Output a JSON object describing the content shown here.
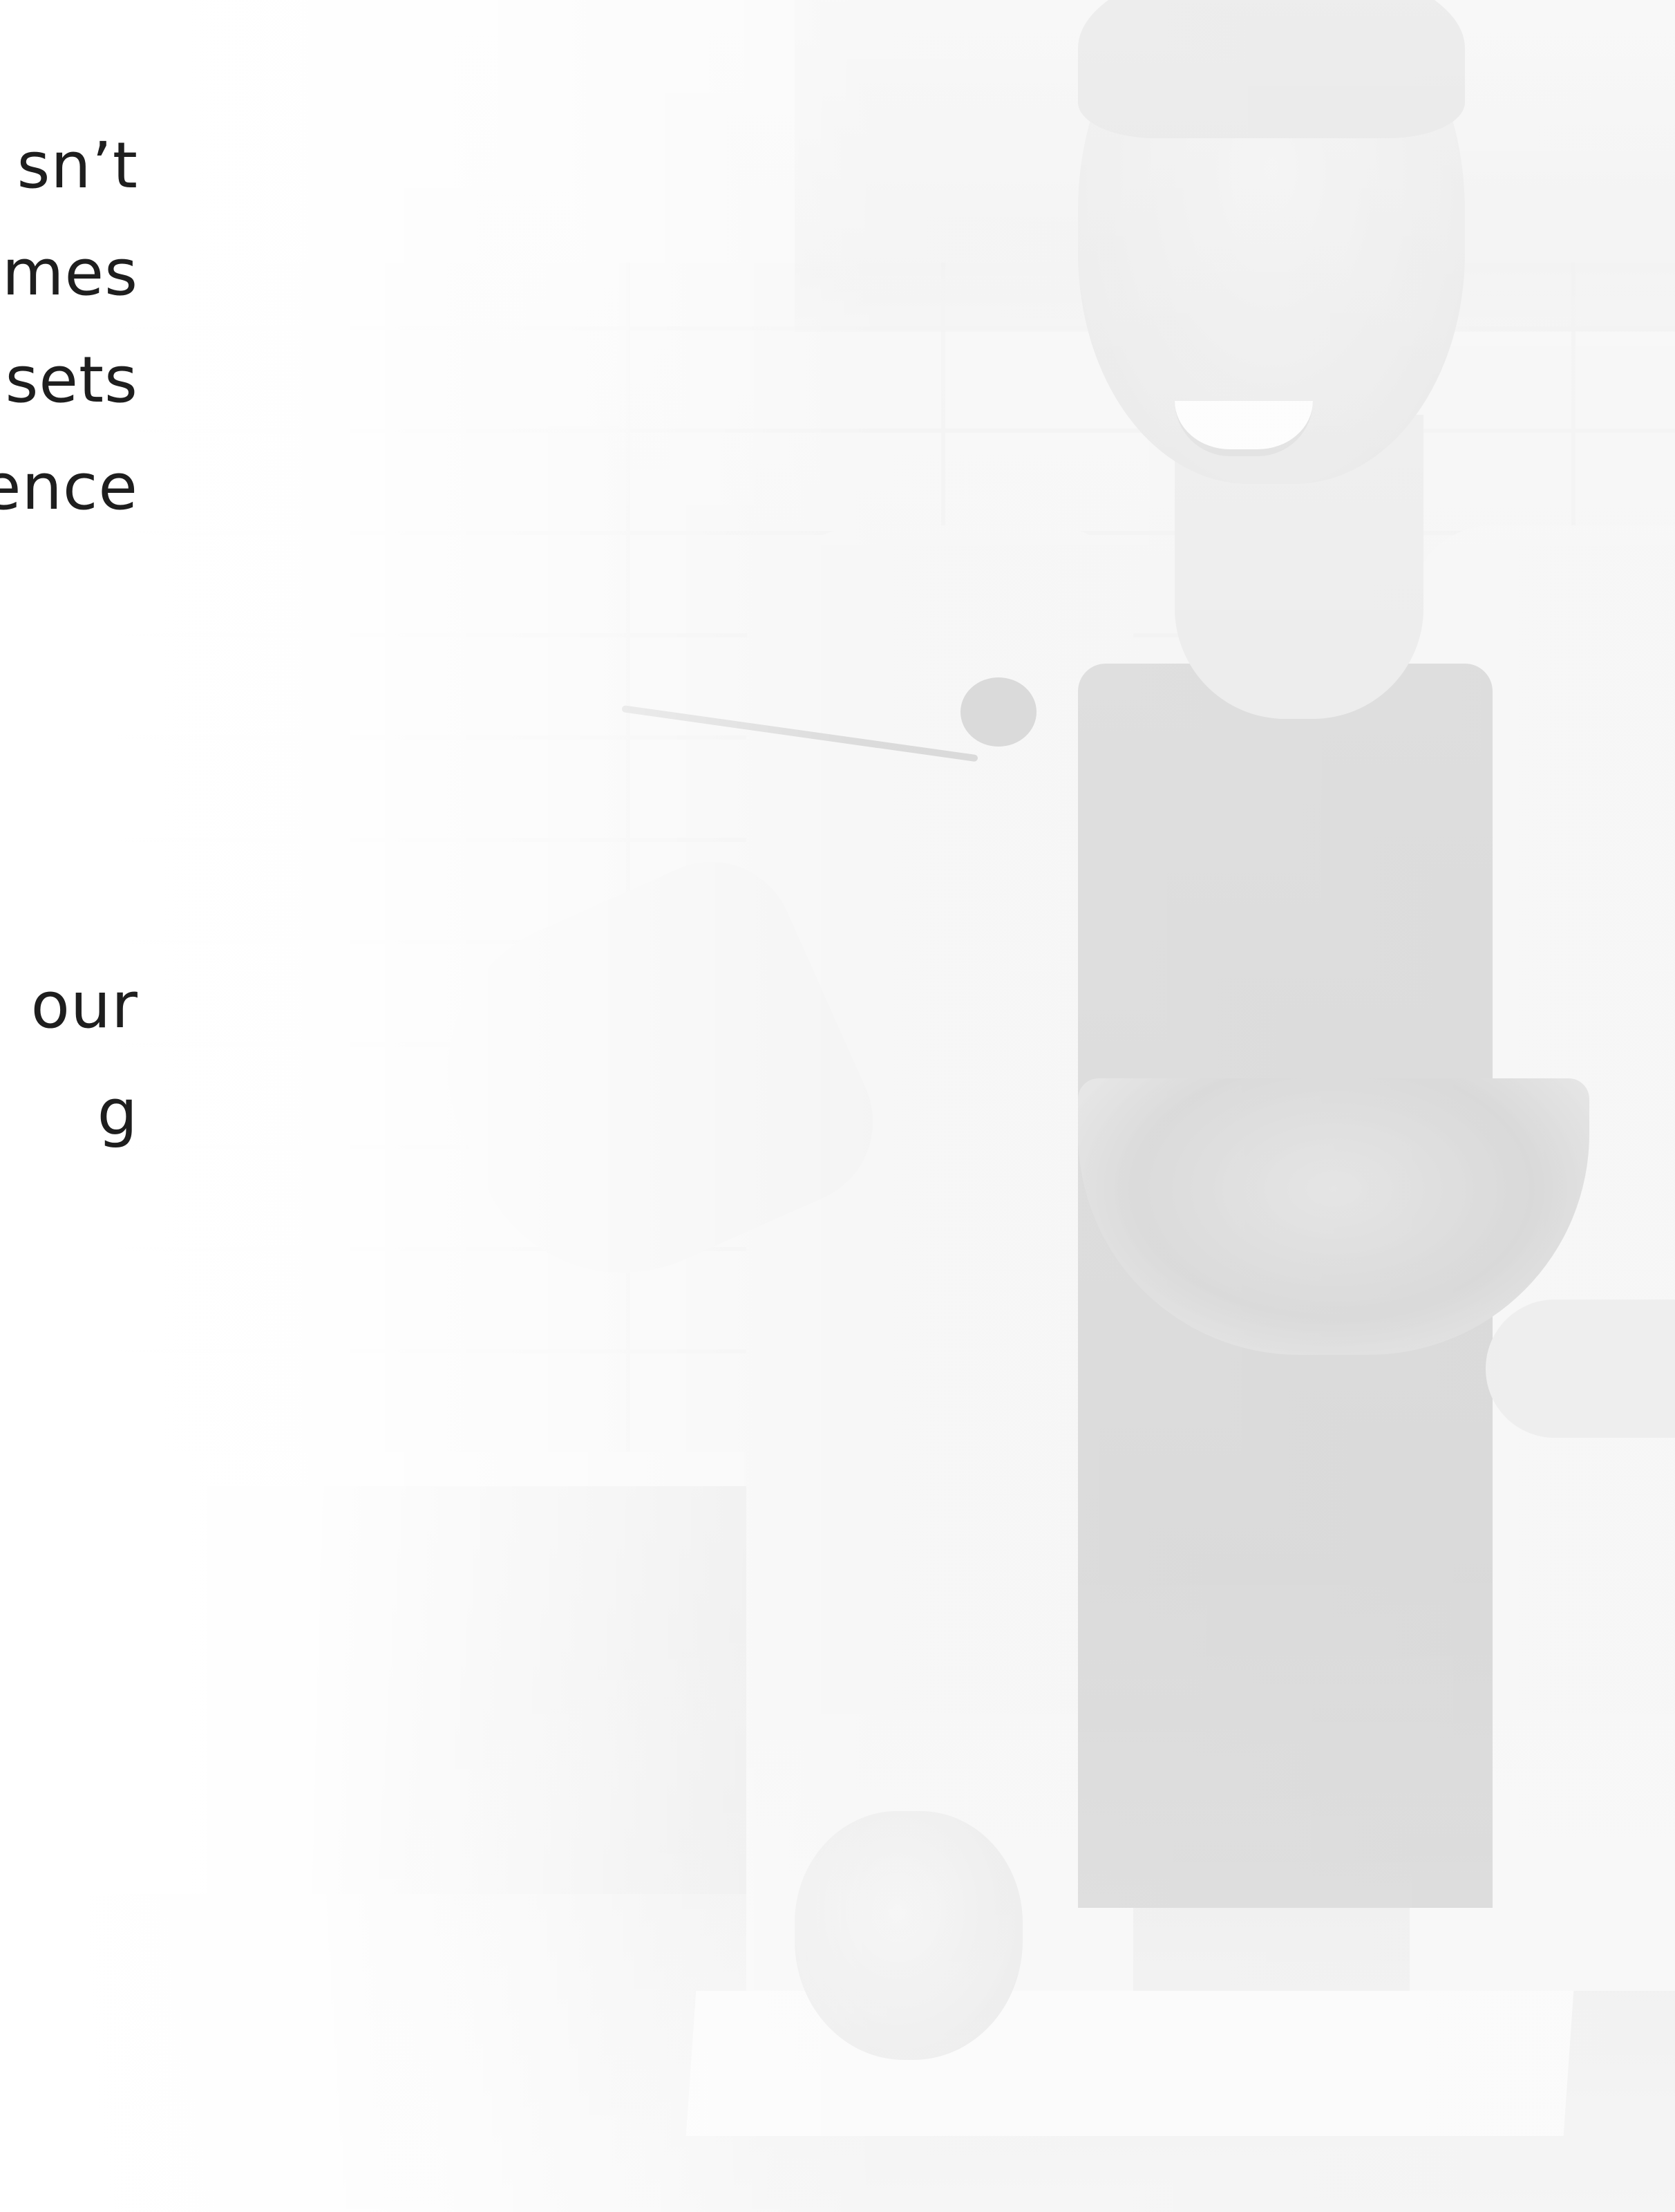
{
  "text_lines": [
    "sn’t",
    "mes",
    "sets",
    "ence",
    "",
    "",
    "",
    "our",
    "g"
  ],
  "photo": {
    "subject": "man-eating-salad-icon"
  }
}
